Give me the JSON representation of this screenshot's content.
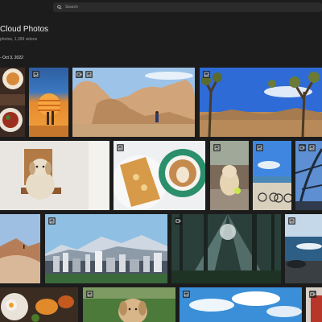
{
  "search": {
    "placeholder": "Search"
  },
  "header": {
    "title": "Cloud Photos",
    "subtitle": "photos, 1,399 videos",
    "date_range": "- Oct 3, 2022"
  },
  "colors": {
    "background": "#1c1c1c",
    "search_bg": "#2b2b2b"
  },
  "photos": [
    {
      "name": "photo-food-plate",
      "icons": [
        "image-icon"
      ]
    },
    {
      "name": "photo-sunset-people",
      "icons": [
        "image-icon"
      ]
    },
    {
      "name": "photo-desert-rocks-hiker",
      "icons": [
        "video-icon",
        "image-icon"
      ]
    },
    {
      "name": "photo-joshua-trees",
      "icons": [
        "image-icon"
      ]
    },
    {
      "name": "photo-dog-on-chair",
      "icons": []
    },
    {
      "name": "photo-toast-and-latte",
      "icons": [
        "image-icon"
      ]
    },
    {
      "name": "photo-dog-with-ball",
      "icons": [
        "image-icon"
      ]
    },
    {
      "name": "photo-bicycles-beach",
      "icons": [
        "image-icon"
      ]
    },
    {
      "name": "photo-eiffel-tower",
      "icons": [
        "video-icon",
        "image-icon"
      ]
    },
    {
      "name": "photo-desert-dune",
      "icons": []
    },
    {
      "name": "photo-city-mountains",
      "icons": [
        "image-icon"
      ]
    },
    {
      "name": "photo-forest-sunbeams",
      "icons": [
        "video-icon"
      ]
    },
    {
      "name": "photo-ocean-rocks",
      "icons": [
        "image-icon"
      ]
    },
    {
      "name": "photo-breakfast",
      "icons": []
    },
    {
      "name": "photo-dog-grass",
      "icons": [
        "image-icon"
      ]
    },
    {
      "name": "photo-sky-clouds",
      "icons": [
        "image-icon"
      ]
    },
    {
      "name": "photo-red-edge",
      "icons": [
        "video-icon"
      ]
    }
  ]
}
